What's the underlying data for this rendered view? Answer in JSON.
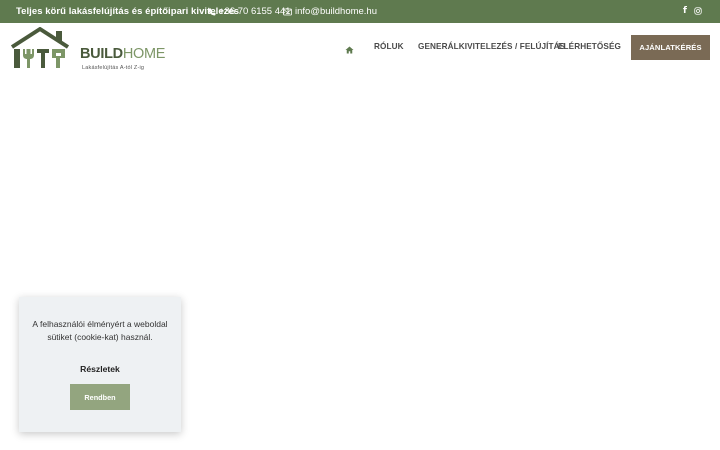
{
  "topbar": {
    "tagline": "Teljes körű lakásfelújítás és építőipari kivitelezés",
    "phone": "+36 70 6155 441",
    "email": "info@buildhome.hu",
    "social_icons": [
      "facebook-icon",
      "instagram-icon"
    ]
  },
  "logo": {
    "brand_part1": "BUILD",
    "brand_part2": "HOME",
    "subtitle": "Lakásfelújítás A-tól Z-ig"
  },
  "nav": {
    "items": [
      "RÓLUK",
      "GENERÁLKIVITELEZÉS / FELÚJÍTÁS",
      "ELÉRHETŐSÉG"
    ],
    "home_icon": "home-icon",
    "cta_label": "AJÁNLATKÉRÉS"
  },
  "cookie": {
    "message": "A felhasználói élményért a weboldal sütiket (cookie-kat) használ.",
    "details_label": "Részletek",
    "ok_label": "Rendben"
  },
  "colors": {
    "topbar": "#5f7a4f",
    "cta": "#7a6a55",
    "cookie_button": "#93a57f",
    "cookie_bg": "#eef1f3"
  }
}
